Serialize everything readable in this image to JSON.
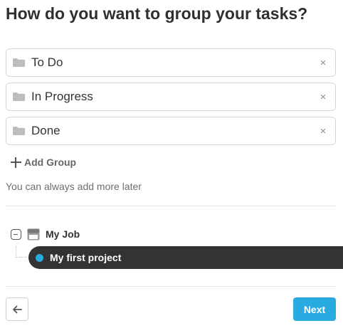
{
  "title": "How do you want to group your tasks?",
  "groups": [
    {
      "name": "To Do",
      "remove_label": "×"
    },
    {
      "name": "In Progress",
      "remove_label": "×"
    },
    {
      "name": "Done",
      "remove_label": "×"
    }
  ],
  "add_group_label": "Add Group",
  "hint": "You can always add more later",
  "tree": {
    "folder": {
      "label": "My Job",
      "expanded": true
    },
    "project": {
      "label": "My first project",
      "color": "#29abe2",
      "selected": true
    }
  },
  "footer": {
    "back_icon": "arrow-left-icon",
    "next_label": "Next"
  },
  "colors": {
    "accent": "#29abe2",
    "selected_row_bg": "#333333",
    "folder_icon": "#bdbdbd"
  }
}
